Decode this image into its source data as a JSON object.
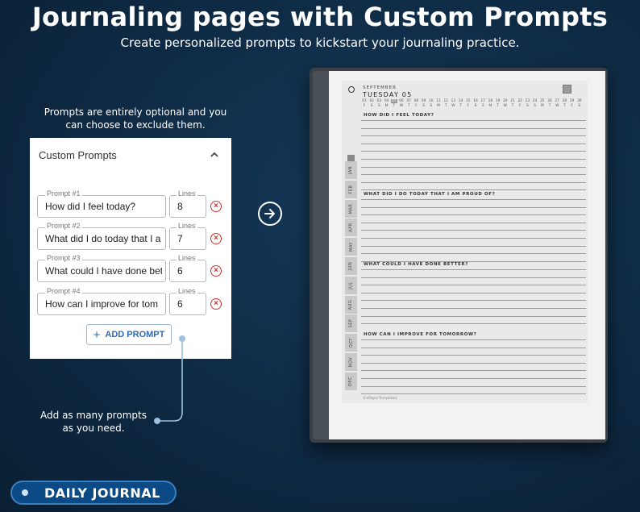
{
  "header": {
    "title": "Journaling pages with Custom Prompts",
    "subtitle": "Create personalized prompts to kickstart your journaling practice."
  },
  "notes": {
    "top_line1": "Prompts are entirely optional and you",
    "top_line2": "can choose to exclude them.",
    "bottom_line1": "Add as many prompts",
    "bottom_line2": "as you need."
  },
  "panel": {
    "title": "Custom Prompts",
    "prompts": [
      {
        "label": "Prompt #1",
        "value": "How did I feel today?",
        "lines_label": "Lines",
        "lines": "8"
      },
      {
        "label": "Prompt #2",
        "value": "What did I do today that I a",
        "lines_label": "Lines",
        "lines": "7"
      },
      {
        "label": "Prompt #3",
        "value": "What could I have done bet",
        "lines_label": "Lines",
        "lines": "6"
      },
      {
        "label": "Prompt #4",
        "value": " How can I improve for tom",
        "lines_label": "Lines",
        "lines": "6"
      }
    ],
    "add_button": "ADD PROMPT"
  },
  "badge": {
    "label": "DAILY JOURNAL"
  },
  "tablet_page": {
    "month": "SEPTEMBER",
    "day": "TUESDAY 05",
    "dates": [
      "01",
      "02",
      "03",
      "04",
      "05",
      "06",
      "07",
      "08",
      "09",
      "10",
      "11",
      "12",
      "13",
      "14",
      "15",
      "16",
      "17",
      "18",
      "19",
      "20",
      "21",
      "22",
      "23",
      "24",
      "25",
      "26",
      "27",
      "28",
      "29",
      "30"
    ],
    "weekdays": [
      "F",
      "S",
      "S",
      "M",
      "T",
      "W",
      "T",
      "F",
      "S",
      "S",
      "M",
      "T",
      "W",
      "T",
      "F",
      "S",
      "S",
      "M",
      "T",
      "W",
      "T",
      "F",
      "S",
      "S",
      "M",
      "T",
      "W",
      "T",
      "F",
      "S"
    ],
    "months": [
      "JAN",
      "FEB",
      "MAR",
      "APR",
      "MAY",
      "JUN",
      "JUL",
      "AUG",
      "SEP",
      "OCT",
      "NOV",
      "DEC"
    ],
    "questions": [
      "HOW DID I FEEL TODAY?",
      "WHAT DID I DO TODAY THAT I AM PROUD OF?",
      "WHAT COULD I HAVE DONE BETTER?",
      "HOW CAN I IMPROVE FOR TOMORROW?"
    ],
    "footer": "©ePaperTemplates"
  },
  "colors": {
    "accent_blue": "#2f6bb3",
    "remove_red": "#d32f2f",
    "badge_bg": "#0c4a86"
  }
}
